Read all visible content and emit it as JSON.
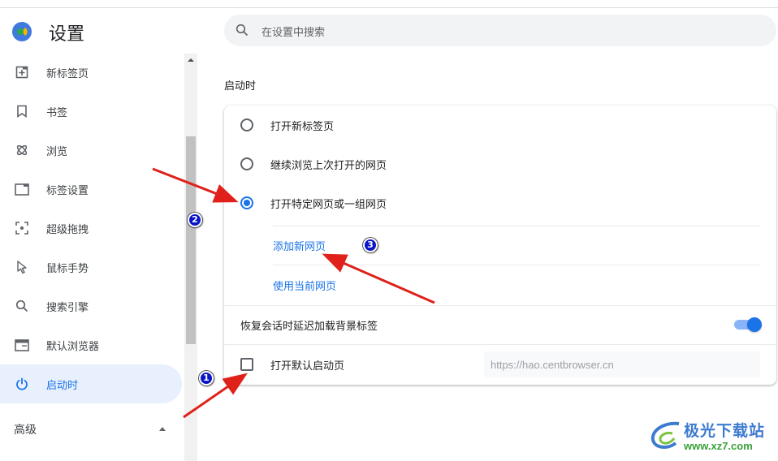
{
  "app": {
    "title": "设置",
    "logo": "cent-browser-logo"
  },
  "sidebar": {
    "items": [
      {
        "label": "新标签页",
        "icon": "new-tab-icon",
        "active": false
      },
      {
        "label": "书签",
        "icon": "bookmark-icon",
        "active": false
      },
      {
        "label": "浏览",
        "icon": "atom-icon",
        "active": false
      },
      {
        "label": "标签设置",
        "icon": "tab-window-icon",
        "active": false
      },
      {
        "label": "超级拖拽",
        "icon": "drag-target-icon",
        "active": false
      },
      {
        "label": "鼠标手势",
        "icon": "cursor-icon",
        "active": false
      },
      {
        "label": "搜索引擎",
        "icon": "search-icon",
        "active": false
      },
      {
        "label": "默认浏览器",
        "icon": "browser-window-icon",
        "active": false
      },
      {
        "label": "启动时",
        "icon": "power-icon",
        "active": true
      }
    ],
    "advanced_label": "高级"
  },
  "search": {
    "placeholder": "在设置中搜索",
    "value": ""
  },
  "main": {
    "section_title": "启动时",
    "startup_options": [
      {
        "label": "打开新标签页",
        "checked": false
      },
      {
        "label": "继续浏览上次打开的网页",
        "checked": false
      },
      {
        "label": "打开特定网页或一组网页",
        "checked": true
      }
    ],
    "links": {
      "add_page": "添加新网页",
      "use_current": "使用当前网页"
    },
    "lazy_load": {
      "label": "恢复会话时延迟加载背景标签",
      "enabled": true
    },
    "default_startup": {
      "label": "打开默认启动页",
      "checked": false,
      "url_placeholder": "https://hao.centbrowser.cn"
    }
  },
  "annotations": {
    "badges": [
      "1",
      "2",
      "3"
    ],
    "arrow_color": "#e0201a",
    "badge_color": "#0a14c8"
  },
  "watermark": {
    "name": "极光下载站",
    "url": "www.xz7.com"
  },
  "colors": {
    "accent": "#1a73e8",
    "active_bg": "#e8f0fe",
    "search_bg": "#f1f3f4"
  }
}
